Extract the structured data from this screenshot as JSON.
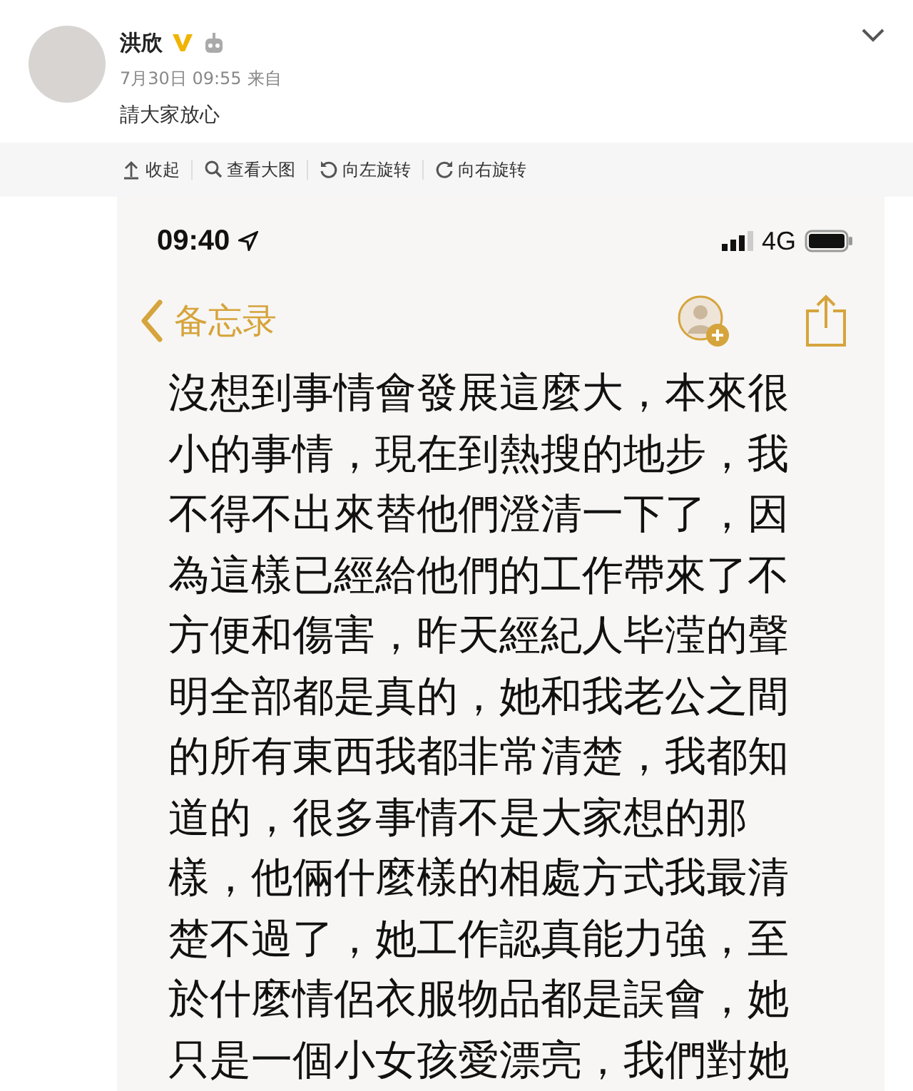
{
  "post": {
    "author": "洪欣",
    "time": "7月30日 09:55",
    "source_label": "来自",
    "text": "請大家放心"
  },
  "toolbar": [
    {
      "kind": "collapse",
      "label": "收起"
    },
    {
      "kind": "zoom",
      "label": "查看大图"
    },
    {
      "kind": "rotate-left",
      "label": "向左旋转"
    },
    {
      "kind": "rotate-right",
      "label": "向右旋转"
    }
  ],
  "phone": {
    "time": "09:40",
    "network": "4G",
    "back_label": "备忘录",
    "note_lines": [
      "沒想到事情會發展這麼大，本來很",
      "小的事情，現在到熱搜的地步，我",
      "不得不出來替他們澄清一下了，因",
      "為這樣已經給他們的工作帶來了不",
      "方便和傷害，昨天經紀人毕滢的聲",
      "明全部都是真的，她和我老公之間",
      "的所有東西我都非常清楚，我都知",
      "道的，很多事情不是大家想的那",
      "樣，他倆什麼樣的相處方式我最清",
      "楚不過了，她工作認真能力強，至",
      "於什麼情侶衣服物品都是誤會，她",
      "只是一個小女孩愛漂亮，我們對她"
    ]
  }
}
